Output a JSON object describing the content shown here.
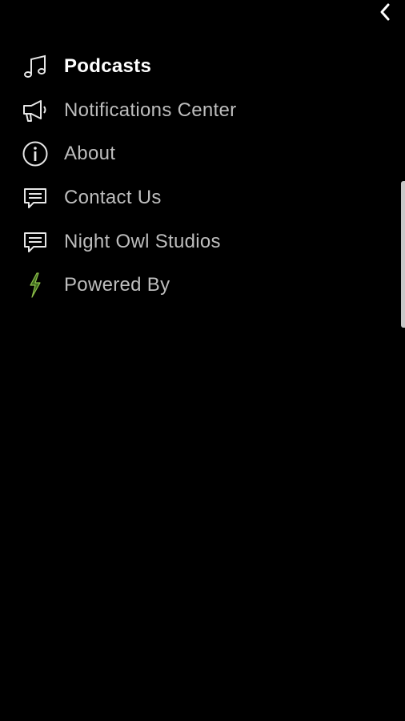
{
  "header": {
    "back_icon": "chevron-left-icon"
  },
  "menu": {
    "items": [
      {
        "label": "Podcasts",
        "icon": "music-note-icon",
        "active": true
      },
      {
        "label": "Notifications Center",
        "icon": "megaphone-icon",
        "active": false
      },
      {
        "label": "About",
        "icon": "info-icon",
        "active": false
      },
      {
        "label": "Contact Us",
        "icon": "chat-bubble-icon",
        "active": false
      },
      {
        "label": "Night Owl Studios",
        "icon": "chat-bubble-icon",
        "active": false
      },
      {
        "label": "Powered By",
        "icon": "lightning-bolt-icon",
        "active": false
      }
    ]
  },
  "colors": {
    "background": "#000000",
    "text": "#bdbdbd",
    "active_text": "#ffffff",
    "icon": "#e6e6e6",
    "bolt_accent": "#7aa83a"
  }
}
